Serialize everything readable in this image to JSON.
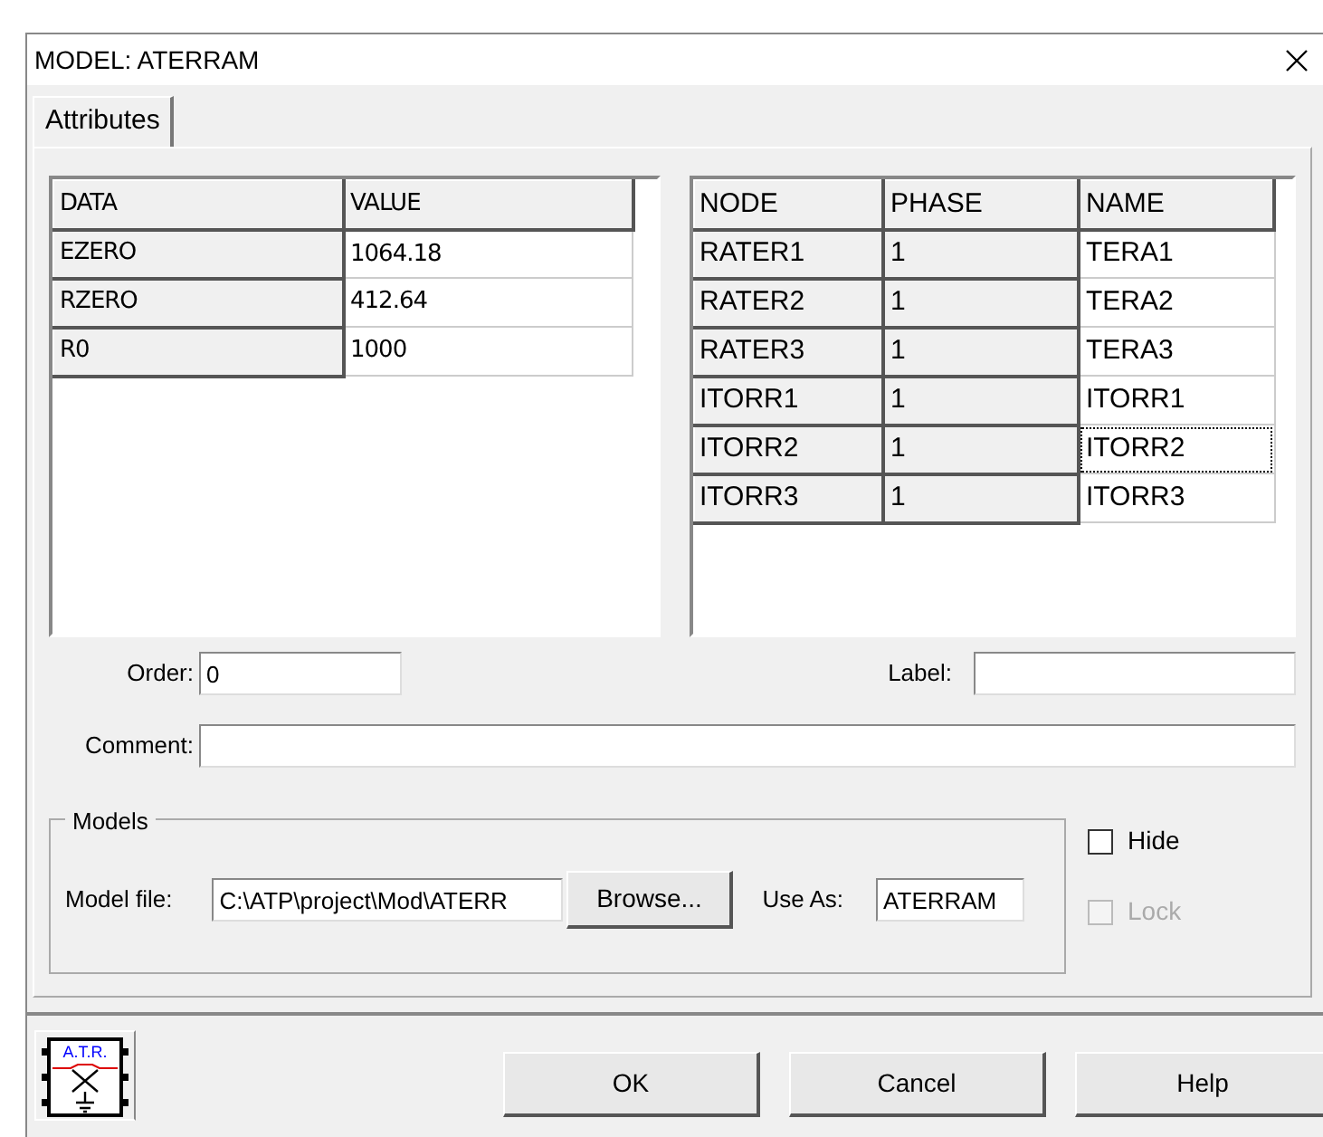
{
  "window": {
    "title": "MODEL: ATERRAM"
  },
  "tabs": [
    {
      "label": "Attributes",
      "selected": true
    }
  ],
  "data_grid": {
    "columns": [
      "DATA",
      "VALUE"
    ],
    "rows": [
      {
        "cells": [
          "EZERO",
          "1064.18"
        ]
      },
      {
        "cells": [
          "RZERO",
          "412.64"
        ]
      },
      {
        "cells": [
          "R0",
          "1000"
        ]
      }
    ]
  },
  "node_grid": {
    "columns": [
      "NODE",
      "PHASE",
      "NAME"
    ],
    "rows": [
      {
        "cells": [
          "RATER1",
          "1",
          "TERA1"
        ],
        "focused": false
      },
      {
        "cells": [
          "RATER2",
          "1",
          "TERA2"
        ],
        "focused": false
      },
      {
        "cells": [
          "RATER3",
          "1",
          "TERA3"
        ],
        "focused": false
      },
      {
        "cells": [
          "ITORR1",
          "1",
          "ITORR1"
        ],
        "focused": false
      },
      {
        "cells": [
          "ITORR2",
          "1",
          "ITORR2"
        ],
        "focused": true
      },
      {
        "cells": [
          "ITORR3",
          "1",
          "ITORR3"
        ],
        "focused": false
      }
    ]
  },
  "order": {
    "label": "Order:",
    "value": "0"
  },
  "label_field": {
    "label": "Label:"
  },
  "comment": {
    "label": "Comment:"
  },
  "models": {
    "title": "Models",
    "model_file_label": "Model file:",
    "model_file": "C:\\ATP\\project\\Mod\\ATERR",
    "browse": "Browse...",
    "use_as_label": "Use As:",
    "use_as": "ATERRAM"
  },
  "checkboxes": [
    {
      "label": "Hide",
      "checked": false,
      "disabled": false
    },
    {
      "label": "Lock",
      "checked": false,
      "disabled": true
    }
  ],
  "component_icon": {
    "caption": "A.T.R."
  },
  "buttons": [
    "OK",
    "Cancel",
    "Help"
  ]
}
